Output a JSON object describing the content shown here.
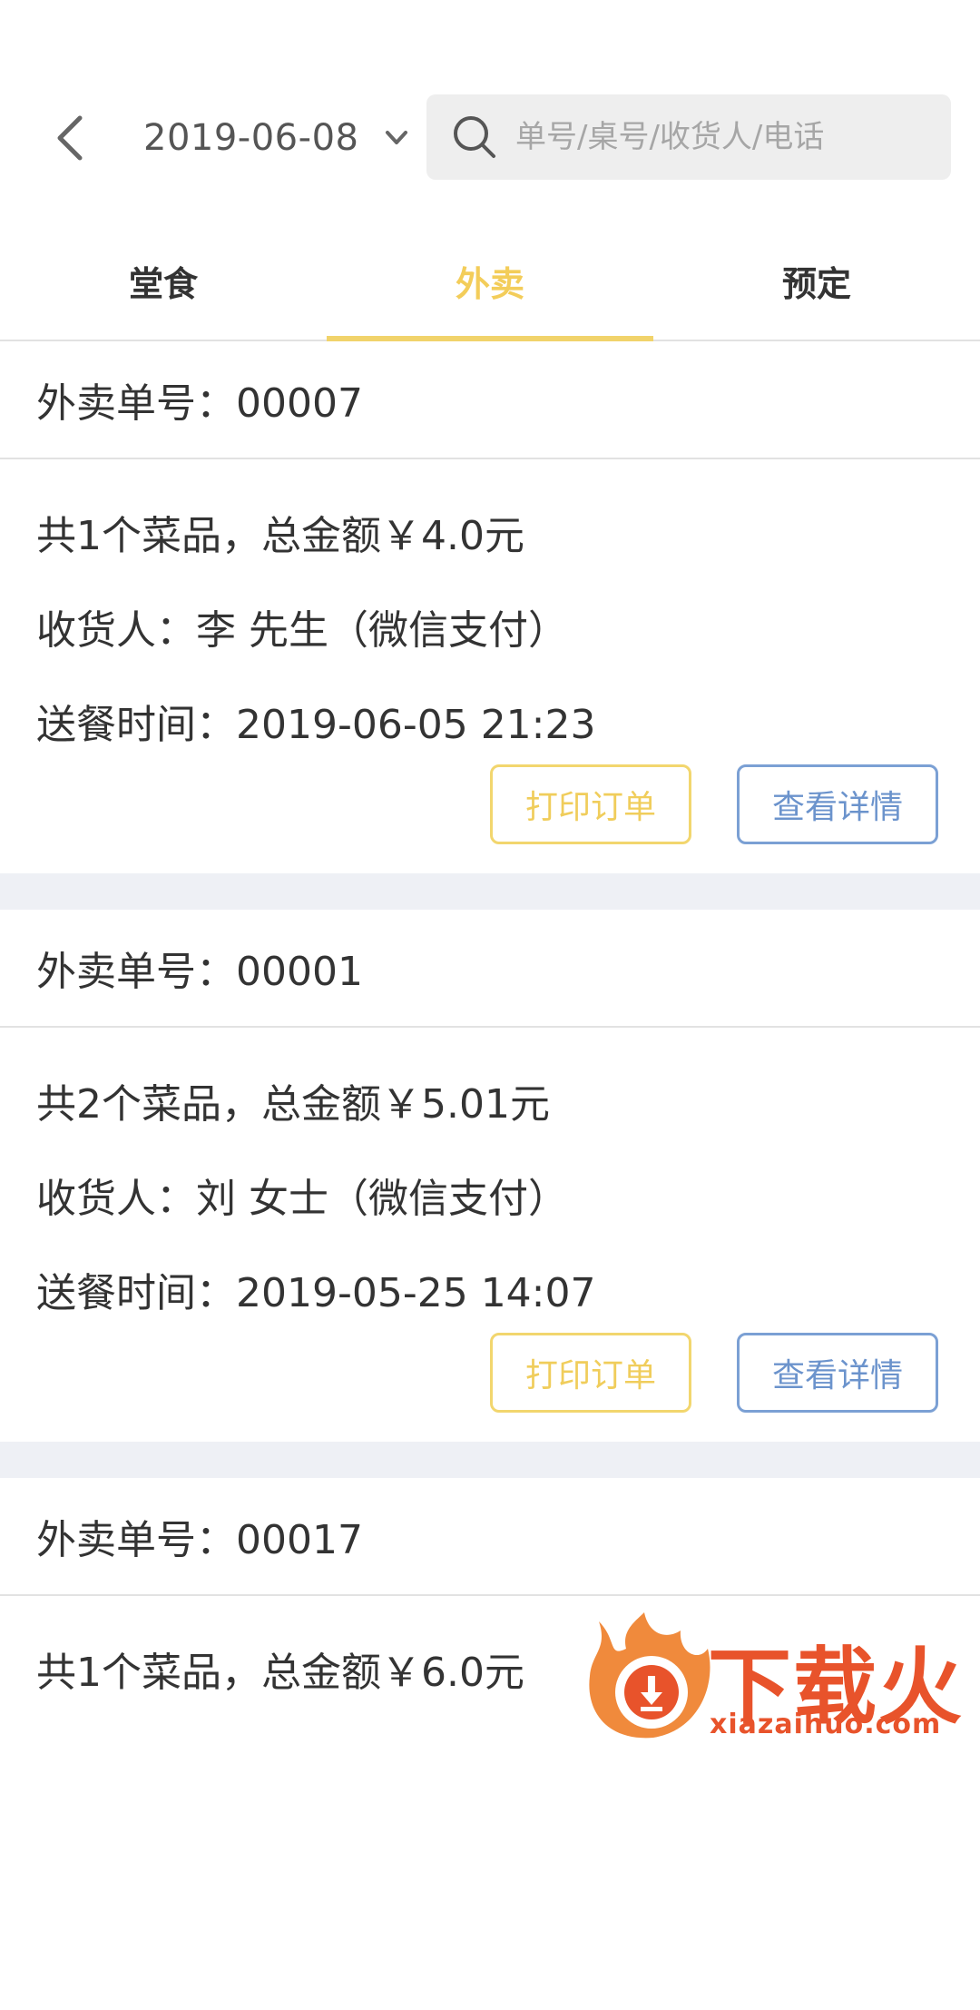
{
  "header": {
    "date": "2019-06-08",
    "search_placeholder": "单号/桌号/收货人/电话"
  },
  "tabs": [
    {
      "label": "堂食",
      "active": false
    },
    {
      "label": "外卖",
      "active": true
    },
    {
      "label": "预定",
      "active": false
    }
  ],
  "orders": [
    {
      "number_line": "外卖单号：00007",
      "summary": "共1个菜品，总金额￥4.0元",
      "recipient": "收货人：李 先生（微信支付）",
      "delivery_time": "送餐时间：2019-06-05 21:23",
      "print_label": "打印订单",
      "detail_label": "查看详情"
    },
    {
      "number_line": "外卖单号：00001",
      "summary": "共2个菜品，总金额￥5.01元",
      "recipient": "收货人：刘 女士（微信支付）",
      "delivery_time": "送餐时间：2019-05-25 14:07",
      "print_label": "打印订单",
      "detail_label": "查看详情"
    },
    {
      "number_line": "外卖单号：00017",
      "summary": "共1个菜品，总金额￥6.0元"
    }
  ],
  "watermark": {
    "brand": "下载火",
    "domain": "xiazaihuo.com"
  },
  "colors": {
    "accent_yellow": "#f3cd5a",
    "detail_blue": "#6b93cc",
    "divider": "#e2e2e2",
    "separator_bg": "#eef0f5",
    "watermark_red": "#e8532b"
  },
  "icons": [
    "back-arrow-icon",
    "chevron-down-icon",
    "search-icon",
    "watermark-flame-logo-icon"
  ]
}
